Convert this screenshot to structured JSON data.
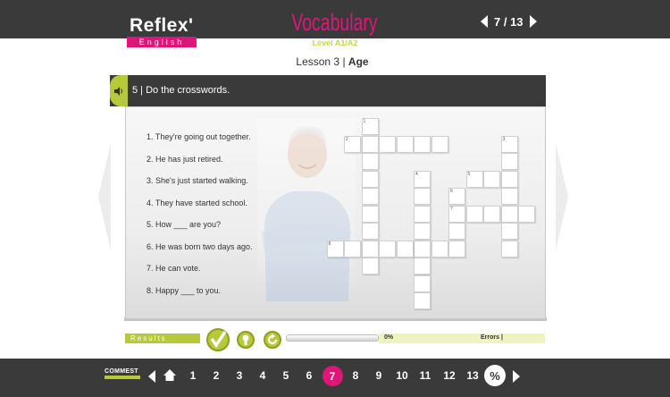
{
  "header": {
    "logo_main": "Reflex'",
    "logo_sub": "English",
    "app_title": "Vocabulary",
    "level": "Level A1/A2",
    "lesson_prefix": "Lesson 3 | ",
    "lesson_topic": "Age",
    "page_indicator": "7 / 13"
  },
  "exercise": {
    "instruction": "5 | Do the crosswords.",
    "clues": [
      "1. They're going out together.",
      "2. He has just retired.",
      "3. She's just started walking.",
      "4. They have started school.",
      "5. How ___  are you?",
      "6. He was born two days ago.",
      "7. He can vote.",
      "8. Happy ___ to you."
    ],
    "crossword_numbers": [
      "1",
      "2",
      "3",
      "4",
      "5",
      "6",
      "7",
      "8"
    ]
  },
  "results": {
    "label": "Results",
    "progress": "0%",
    "progress_value": 0,
    "errors_label": "Errors |"
  },
  "footer": {
    "brand": "COMMEST",
    "pages": [
      "1",
      "2",
      "3",
      "4",
      "5",
      "6",
      "7",
      "8",
      "9",
      "10",
      "11",
      "12",
      "13"
    ],
    "current_page": "7",
    "percent_symbol": "%"
  },
  "colors": {
    "accent_pink": "#e0157a",
    "accent_green": "#b7c83a",
    "bar_dark": "#3a3a3a"
  },
  "icons": [
    "speaker-icon",
    "check-icon",
    "hint-icon",
    "reset-icon",
    "home-icon",
    "prev-arrow-icon",
    "next-arrow-icon",
    "percent-icon"
  ]
}
